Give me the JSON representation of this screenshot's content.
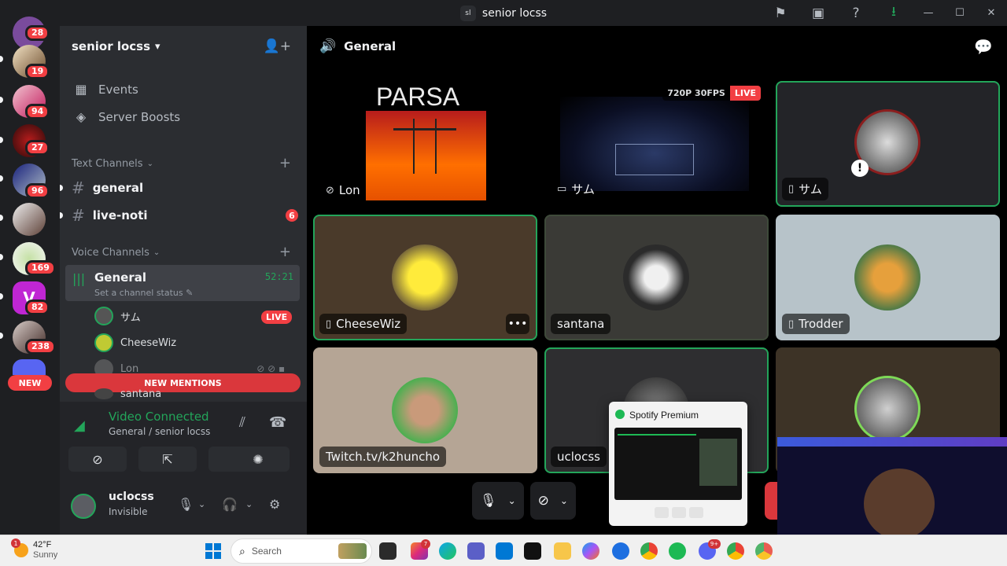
{
  "window": {
    "server_abbrev": "sl",
    "title": "senior locss"
  },
  "guilds": {
    "badges": [
      "28",
      "19",
      "94",
      "27",
      "96",
      "169",
      "82",
      "238"
    ],
    "new_label": "NEW"
  },
  "server": {
    "name": "senior locss",
    "chevron": "⌄"
  },
  "sidebar": {
    "events": "Events",
    "boosts": "Server Boosts",
    "text_category": "Text Channels",
    "text_channels": [
      {
        "name": "general",
        "mentions": ""
      },
      {
        "name": "live-noti",
        "mentions": "6"
      }
    ],
    "voice_category": "Voice Channels",
    "voice_channel": {
      "name": "General",
      "time": "52:21",
      "status": "Set a channel status"
    },
    "voice_users": [
      {
        "name": "サム",
        "live": "LIVE"
      },
      {
        "name": "CheeseWiz"
      },
      {
        "name": "Lon"
      },
      {
        "name": "santana"
      }
    ],
    "new_mentions": "NEW MENTIONS"
  },
  "voice_connection": {
    "title": "Video Connected",
    "subtitle": "General / senior locss"
  },
  "user": {
    "name": "uclocss",
    "status": "Invisible"
  },
  "main": {
    "channel_title": "General",
    "tiles": [
      {
        "label": "Lon",
        "overlay_text": "PARSA"
      },
      {
        "label": "サム",
        "quality": "720P 30FPS",
        "live": "LIVE"
      },
      {
        "label": "サム"
      },
      {
        "label": "CheeseWiz"
      },
      {
        "label": "santana"
      },
      {
        "label": "Trodder"
      },
      {
        "label": "Twitch.tv/k2huncho"
      },
      {
        "label": "uclocss"
      },
      {
        "label": ""
      }
    ]
  },
  "spotify_popup": {
    "title": "Spotify Premium"
  },
  "taskbar": {
    "temperature": "42°F",
    "condition": "Sunny",
    "weather_badge": "1",
    "search_placeholder": "Search",
    "instagram_badge": "7",
    "discord_badge": "9+"
  },
  "colors": {
    "accent_green": "#23a55a",
    "danger_red": "#f23f43",
    "bg_dark": "#1e1f22"
  }
}
